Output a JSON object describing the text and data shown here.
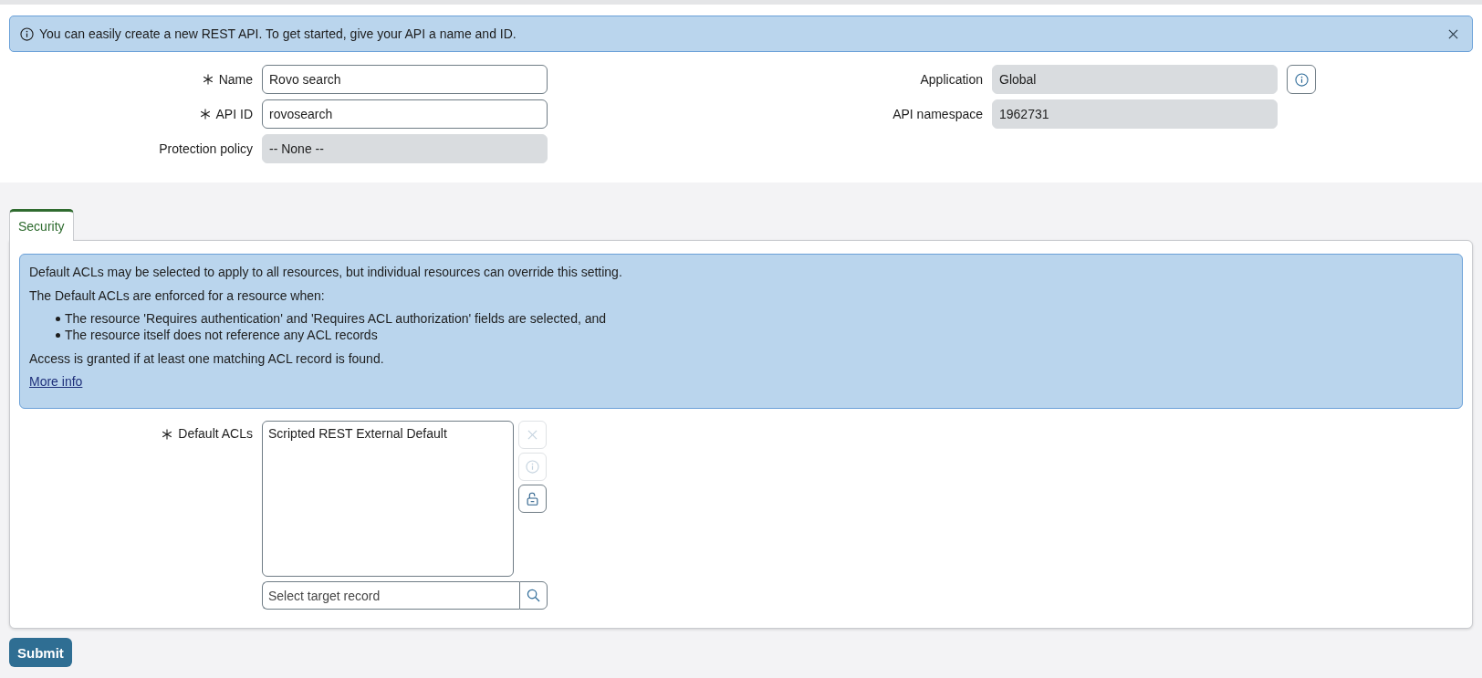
{
  "banner": {
    "text": "You can easily create a new REST API. To get started, give your API a name and ID."
  },
  "form": {
    "left": [
      {
        "label": "Name",
        "required": true,
        "value": "Rovo search",
        "readonly": false
      },
      {
        "label": "API ID",
        "required": true,
        "value": "rovosearch",
        "readonly": false
      },
      {
        "label": "Protection policy",
        "required": false,
        "value": "-- None --",
        "readonly": true
      }
    ],
    "right": [
      {
        "label": "Application",
        "value": "Global",
        "readonly": true,
        "info_button": true
      },
      {
        "label": "API namespace",
        "value": "1962731",
        "readonly": true,
        "info_button": false
      }
    ]
  },
  "tabs": [
    {
      "label": "Security",
      "selected": true
    }
  ],
  "security": {
    "info": {
      "intro": "Default ACLs may be selected to apply to all resources, but individual resources can override this setting.",
      "lead": "The Default ACLs are enforced for a resource when:",
      "bullets": [
        "The resource 'Requires authentication' and 'Requires ACL authorization' fields are selected, and",
        "The resource itself does not reference any ACL records"
      ],
      "note": "Access is granted if at least one matching ACL record is found.",
      "link": "More info"
    },
    "default_acls": {
      "label": "Default ACLs",
      "required": true,
      "items": [
        "Scripted REST External Default"
      ],
      "actions": [
        {
          "kind": "remove",
          "disabled": true
        },
        {
          "kind": "info",
          "disabled": true
        },
        {
          "kind": "lock",
          "disabled": false
        }
      ],
      "picker": {
        "placeholder": "Select target record"
      }
    }
  },
  "submit": {
    "label": "Submit"
  }
}
